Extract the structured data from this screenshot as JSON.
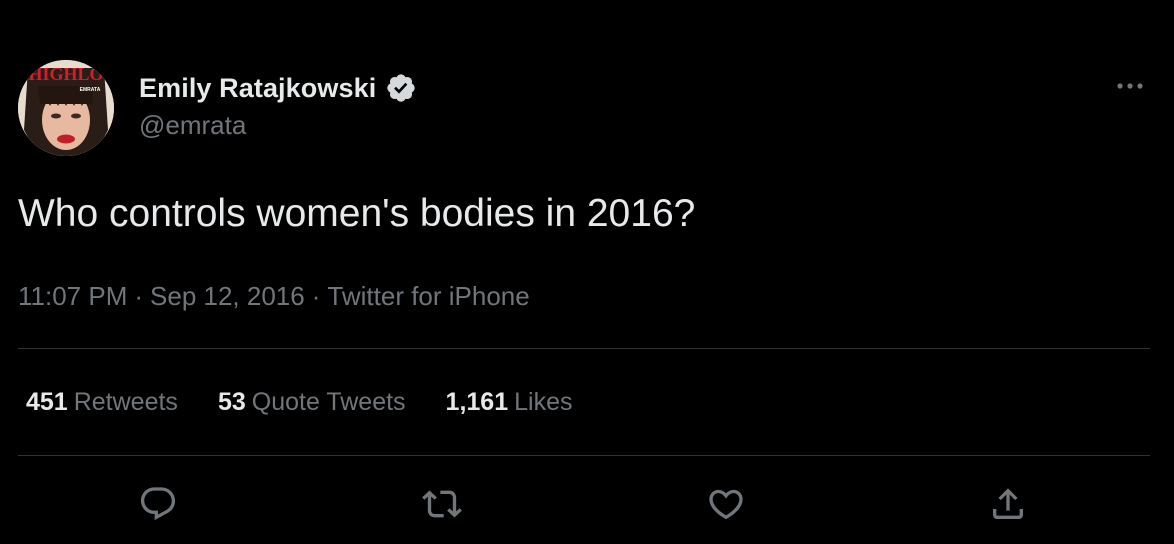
{
  "user": {
    "display_name": "Emily Ratajkowski",
    "handle": "@emrata",
    "verified": true,
    "avatar_magazine_text": "HIGHLO",
    "avatar_overlay_text": "EMRATA"
  },
  "tweet": {
    "text": "Who controls women's bodies in 2016?",
    "time": "11:07 PM",
    "date": "Sep 12, 2016",
    "source": "Twitter for iPhone",
    "separator": "·"
  },
  "stats": {
    "retweets_count": "451",
    "retweets_label": "Retweets",
    "quotes_count": "53",
    "quotes_label": "Quote Tweets",
    "likes_count": "1,161",
    "likes_label": "Likes"
  },
  "actions": {
    "icons": [
      "reply-icon",
      "retweet-icon",
      "like-icon",
      "share-icon"
    ]
  },
  "colors": {
    "background": "#000000",
    "primary_text": "#e7e9ea",
    "secondary_text": "#71767b",
    "divider": "#2f3336"
  }
}
